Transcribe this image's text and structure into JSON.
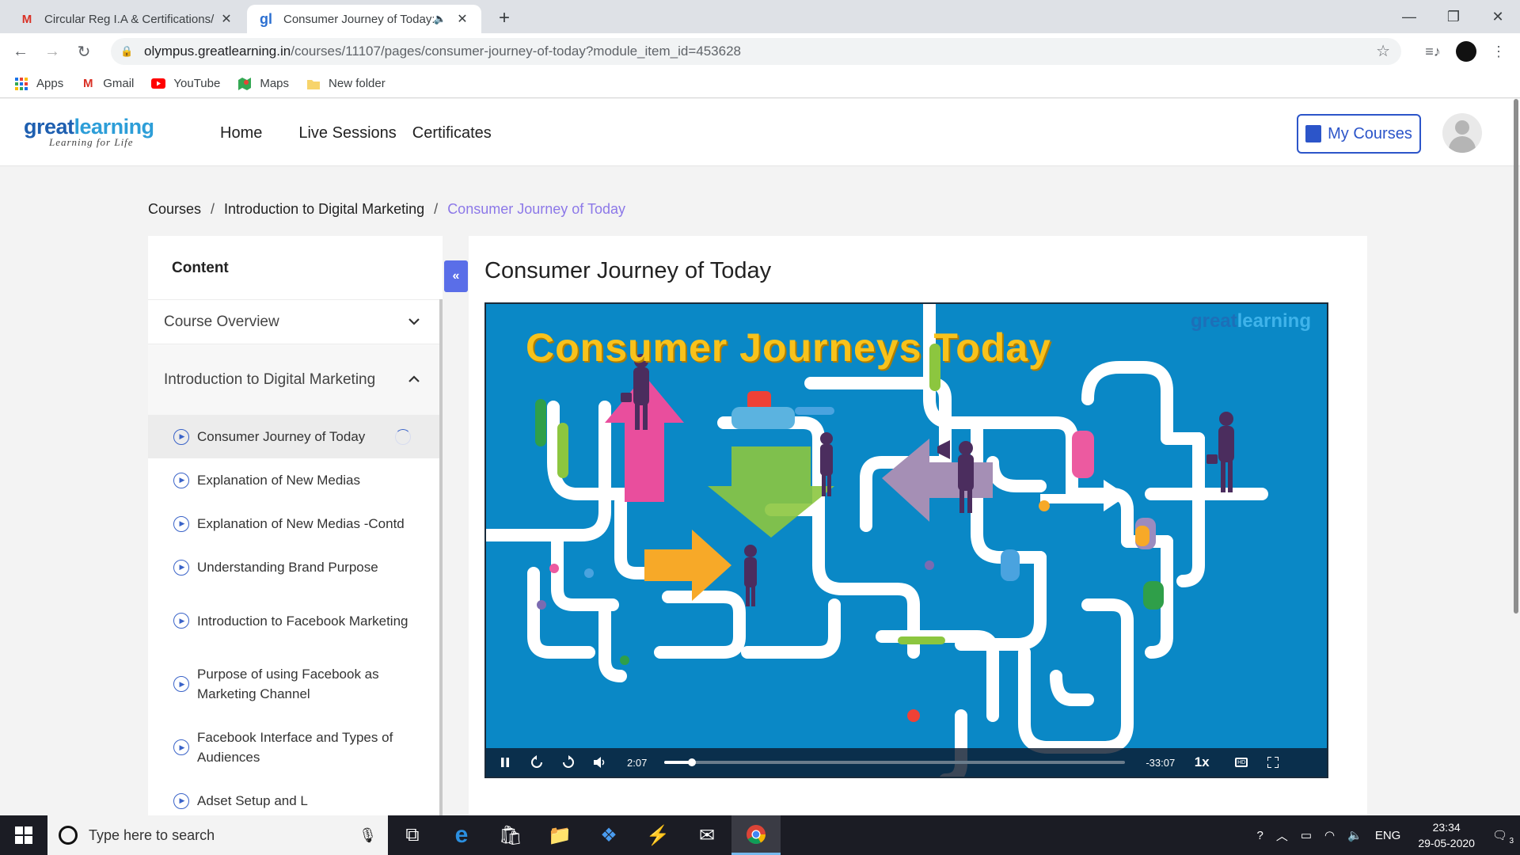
{
  "browser": {
    "tabs": [
      {
        "title": "Circular Reg I.A & Certifications/",
        "favicon": "M",
        "active": false
      },
      {
        "title": "Consumer Journey of Today:",
        "favicon": "gl",
        "active": true
      }
    ],
    "url_host": "olympus.greatlearning.in",
    "url_path": "/courses/11107/pages/consumer-journey-of-today?module_item_id=453628",
    "profile_initial": "",
    "bookmarks": [
      {
        "label": "Apps",
        "icon": "apps-grid-icon"
      },
      {
        "label": "Gmail",
        "icon": "gmail-icon"
      },
      {
        "label": "YouTube",
        "icon": "youtube-icon"
      },
      {
        "label": "Maps",
        "icon": "maps-icon"
      },
      {
        "label": "New folder",
        "icon": "folder-icon"
      }
    ]
  },
  "site": {
    "logo_part1": "great",
    "logo_part2": "learning",
    "logo_tagline": "Learning for Life",
    "nav": [
      "Home",
      "Live Sessions",
      "Certificates"
    ],
    "my_courses": "My Courses"
  },
  "breadcrumb": [
    "Courses",
    "Introduction to Digital Marketing",
    "Consumer Journey of Today"
  ],
  "sidebar": {
    "heading": "Content",
    "sections": [
      {
        "label": "Course Overview",
        "expanded": false
      },
      {
        "label": "Introduction to Digital Marketing",
        "expanded": true
      }
    ],
    "items": [
      {
        "label": "Consumer Journey of Today",
        "active": true
      },
      {
        "label": "Explanation of New Medias",
        "active": false
      },
      {
        "label": "Explanation of New Medias -Contd",
        "active": false
      },
      {
        "label": "Understanding Brand Purpose",
        "active": false
      },
      {
        "label": "Introduction to Facebook Marketing",
        "active": false
      },
      {
        "label": "Purpose of using Facebook as Marketing Channel",
        "active": false
      },
      {
        "label": "Facebook Interface and Types of Audiences",
        "active": false
      },
      {
        "label": "Adset Setup and L",
        "active": false
      }
    ]
  },
  "page": {
    "title": "Consumer Journey of Today"
  },
  "video": {
    "heading": "Consumer Journeys Today",
    "watermark_part1": "great",
    "watermark_part2": "learning",
    "elapsed": "2:07",
    "remaining": "-33:07",
    "speed": "1x",
    "progress": 0.06,
    "state": "playing"
  },
  "taskbar": {
    "search_placeholder": "Type here to search",
    "language": "ENG",
    "time": "23:34",
    "date": "29-05-2020",
    "notifications": "3"
  }
}
